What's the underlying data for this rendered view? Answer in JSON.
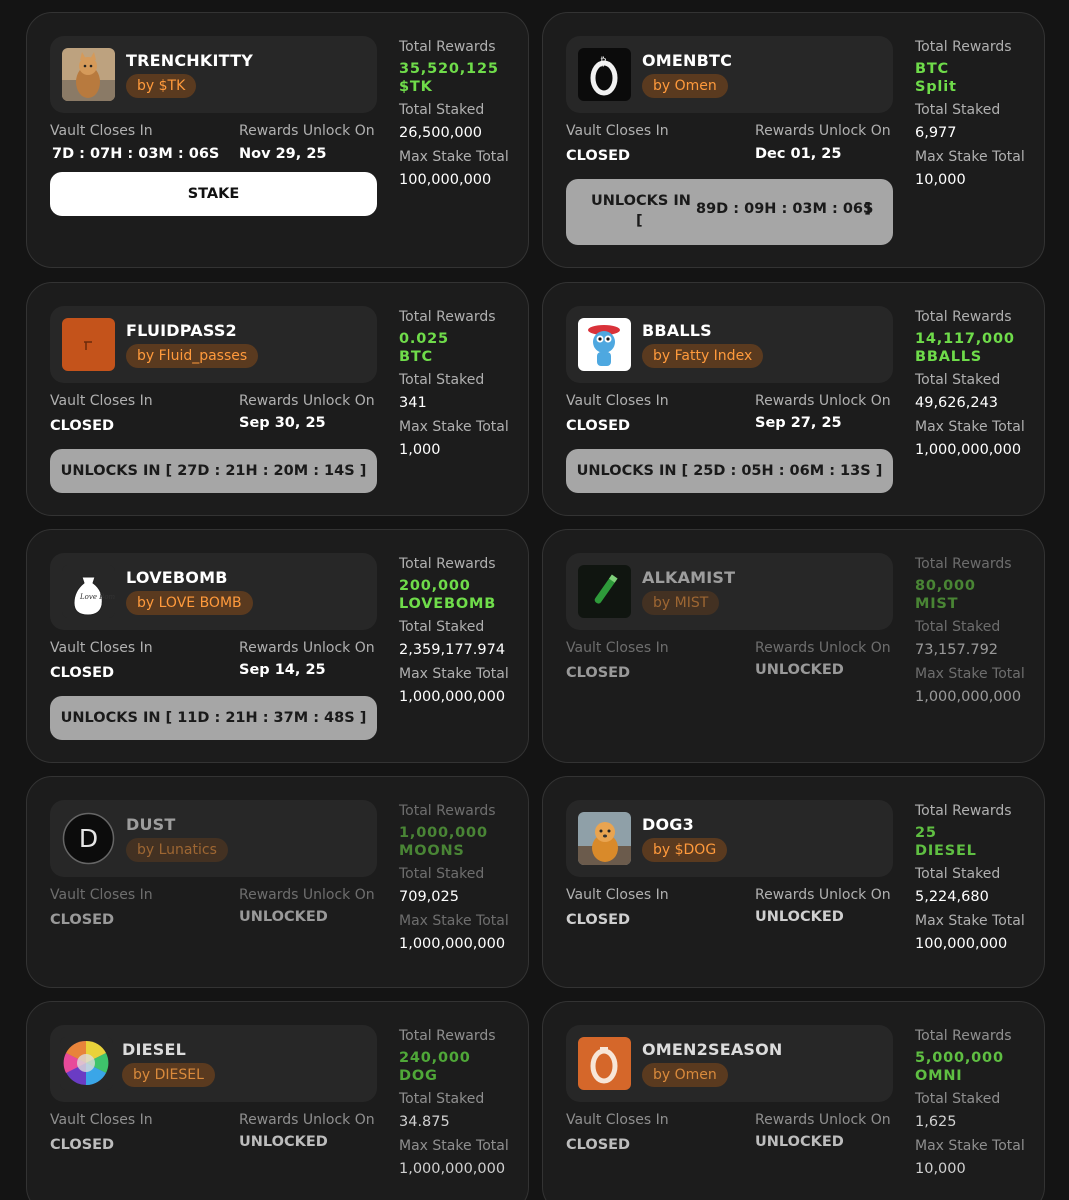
{
  "labels": {
    "total_rewards": "Total Rewards",
    "total_staked": "Total Staked",
    "max_stake_total": "Max Stake Total",
    "vault_closes_in": "Vault Closes In",
    "rewards_unlock_on": "Rewards Unlock On"
  },
  "colors": {
    "background": "#141414",
    "card": "#1c1c1c",
    "reward_green": "#6fdc4a",
    "publisher_orange": "#ff9a3c",
    "stake_button": "#ffffff",
    "unlock_button": "#a6a6a6"
  },
  "vaults": [
    {
      "name": "TRENCHKITTY",
      "by": "by $TK",
      "icon": "cat-photo-icon",
      "reward_amount": "35,520,125",
      "reward_token": "$TK",
      "total_staked": "26,500,000",
      "max_stake": "100,000,000",
      "closes_in": "7D : 07H : 03M : 06S",
      "unlock_on": "Nov 29, 25",
      "button": "STAKE"
    },
    {
      "name": "OMENBTC",
      "by": "by Omen",
      "icon": "omen-bitcoin-icon",
      "reward_amount": "BTC",
      "reward_token": "Split",
      "total_staked": "6,977",
      "max_stake": "10,000",
      "closes_in": "CLOSED",
      "unlock_on": "Dec 01, 25",
      "button_line1": "UNLOCKS IN",
      "button_line2": "[",
      "button_timer": "89D : 09H : 03M : 06S",
      "button_end": "]"
    },
    {
      "name": "FLUIDPASS2",
      "by": "by Fluid_passes",
      "icon": "fluid-pass-icon",
      "reward_amount": "0.025",
      "reward_token": "BTC",
      "total_staked": "341",
      "max_stake": "1,000",
      "closes_in": "CLOSED",
      "unlock_on": "Sep 30, 25",
      "button": "UNLOCKS IN [  27D : 21H : 20M : 14S  ]"
    },
    {
      "name": "BBALLS",
      "by": "by Fatty Index",
      "icon": "clown-character-icon",
      "reward_amount": "14,117,000",
      "reward_token": "BBALLS",
      "total_staked": "49,626,243",
      "max_stake": "1,000,000,000",
      "closes_in": "CLOSED",
      "unlock_on": "Sep 27, 25",
      "button": "UNLOCKS IN [  25D : 05H : 06M : 13S  ]"
    },
    {
      "name": "LOVEBOMB",
      "by": "by LOVE BOMB",
      "icon": "love-bomb-bag-icon",
      "icon_text": "Love Bomb",
      "reward_amount": "200,000",
      "reward_token": "LOVEBOMB",
      "total_staked": "2,359,177.974",
      "max_stake": "1,000,000,000",
      "closes_in": "CLOSED",
      "unlock_on": "Sep 14, 25",
      "button": "UNLOCKS IN [  11D : 21H : 37M : 48S  ]"
    },
    {
      "name": "ALKAMIST",
      "by": "by MIST",
      "icon": "green-vial-icon",
      "reward_amount": "80,000",
      "reward_token": "MIST",
      "total_staked": "73,157.792",
      "max_stake": "1,000,000,000",
      "closes_in": "CLOSED",
      "unlock_on": "UNLOCKED"
    },
    {
      "name": "DUST",
      "by": "by Lunatics",
      "icon": "letter-d-icon",
      "icon_letter": "D",
      "reward_amount": "1,000,000",
      "reward_token": "MOONS",
      "total_staked": "709,025",
      "max_stake": "1,000,000,000",
      "closes_in": "CLOSED",
      "unlock_on": "UNLOCKED"
    },
    {
      "name": "DOG3",
      "by": "by $DOG",
      "icon": "dog-photo-icon",
      "reward_amount": "25",
      "reward_token": "DIESEL",
      "total_staked": "5,224,680",
      "max_stake": "100,000,000",
      "closes_in": "CLOSED",
      "unlock_on": "UNLOCKED"
    },
    {
      "name": "DIESEL",
      "by": "by DIESEL",
      "icon": "rainbow-orb-icon",
      "reward_amount": "240,000",
      "reward_token": "DOG",
      "total_staked": "34.875",
      "max_stake": "1,000,000,000",
      "closes_in": "CLOSED",
      "unlock_on": "UNLOCKED"
    },
    {
      "name": "OMEN2SEASON",
      "by": "by Omen",
      "icon": "omen-orange-icon",
      "reward_amount": "5,000,000",
      "reward_token": "OMNI",
      "total_staked": "1,625",
      "max_stake": "10,000",
      "closes_in": "CLOSED",
      "unlock_on": "UNLOCKED"
    }
  ]
}
